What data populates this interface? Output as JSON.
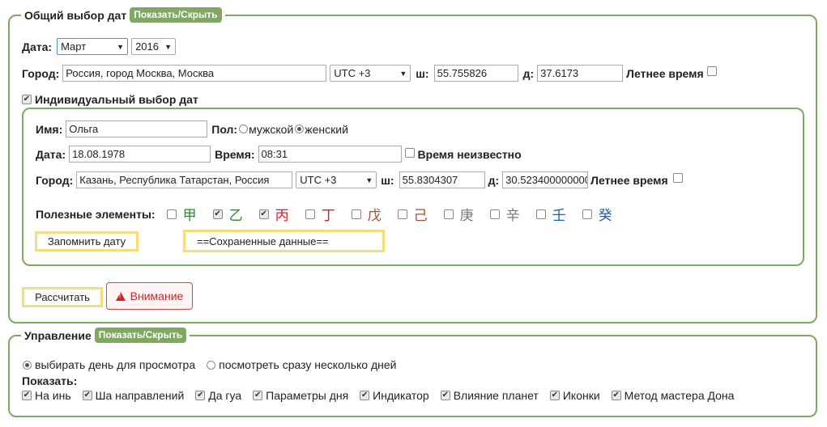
{
  "general": {
    "legend": "Общий выбор дат",
    "toggle_label": "Показать/Скрыть",
    "date_label": "Дата:",
    "month_value": "Март",
    "year_value": "2016",
    "city_label": "Город:",
    "city_value": "Россия, город Москва, Москва",
    "utc_value": "UTC +3",
    "lat_label": "ш:",
    "lat_value": "55.755826",
    "lon_label": "д:",
    "lon_value": "37.6173",
    "dst_label": "Летнее время",
    "individual_label": "Индивидуальный выбор дат"
  },
  "individual": {
    "name_label": "Имя:",
    "name_value": "Ольга",
    "gender_label": "Пол:",
    "male_label": "мужской",
    "female_label": "женский",
    "date_label": "Дата:",
    "date_value": "18.08.1978",
    "time_label": "Время:",
    "time_value": "08:31",
    "time_unknown_label": "Время неизвестно",
    "city_label": "Город:",
    "city_value": "Казань, Республика Татарстан, Россия",
    "utc_value": "UTC +3",
    "lat_label": "ш:",
    "lat_value": "55.8304307",
    "lon_label": "д:",
    "lon_value": "30.523400000000",
    "dst_label": "Летнее время",
    "elements_label": "Полезные элементы:",
    "elements": [
      {
        "glyph": "甲",
        "color": "#2e8b2e",
        "checked": false
      },
      {
        "glyph": "乙",
        "color": "#2e8b2e",
        "checked": true
      },
      {
        "glyph": "丙",
        "color": "#d42020",
        "checked": true
      },
      {
        "glyph": "丁",
        "color": "#d42020",
        "checked": false
      },
      {
        "glyph": "戊",
        "color": "#a0522d",
        "checked": false
      },
      {
        "glyph": "己",
        "color": "#a0522d",
        "checked": false
      },
      {
        "glyph": "庚",
        "color": "#777777",
        "checked": false
      },
      {
        "glyph": "辛",
        "color": "#777777",
        "checked": false
      },
      {
        "glyph": "壬",
        "color": "#1f5fa8",
        "checked": false
      },
      {
        "glyph": "癸",
        "color": "#1f5fa8",
        "checked": false
      }
    ],
    "remember_label": "Запомнить дату",
    "saved_label": "==Сохраненные данные=="
  },
  "actions": {
    "calculate_label": "Рассчитать",
    "warning_label": "Внимание"
  },
  "control": {
    "legend": "Управление",
    "toggle_label": "Показать/Скрыть",
    "view_single_label": "выбирать день для просмотра",
    "view_multi_label": "посмотреть сразу несколько дней",
    "show_label": "Показать:",
    "options": [
      {
        "label": "На инь"
      },
      {
        "label": "Ша направлений"
      },
      {
        "label": "Да гуа"
      },
      {
        "label": "Параметры дня"
      },
      {
        "label": "Индикатор"
      },
      {
        "label": "Влияние планет"
      },
      {
        "label": "Иконки"
      },
      {
        "label": "Метод мастера Дона"
      }
    ]
  },
  "colors": {
    "accent": "#7fa860",
    "button_border": "#f5dc7d",
    "warning": "#c82828"
  }
}
